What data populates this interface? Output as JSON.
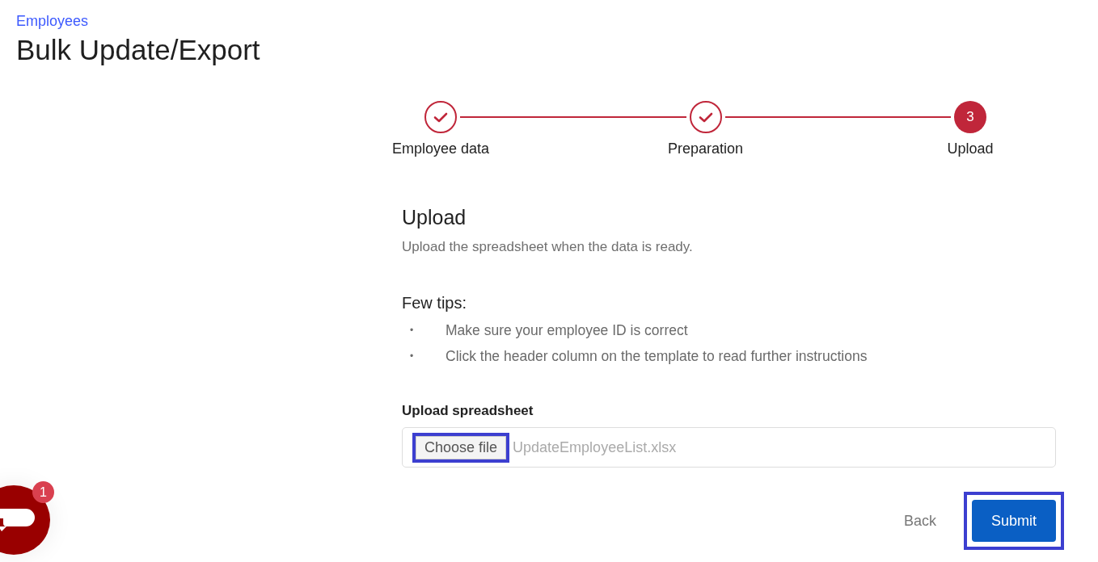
{
  "breadcrumb": "Employees",
  "title": "Bulk Update/Export",
  "steps": [
    {
      "label": "Employee data",
      "done": true
    },
    {
      "label": "Preparation",
      "done": true
    },
    {
      "label": "Upload",
      "done": false,
      "number": "3"
    }
  ],
  "section": {
    "heading": "Upload",
    "description": "Upload the spreadsheet when the data is ready."
  },
  "tips": {
    "heading": "Few tips:",
    "items": [
      {
        "bullet": "•",
        "text": "Make sure your employee ID is correct"
      },
      {
        "bullet": "•",
        "text": "Click the header column on the template to read further instructions"
      }
    ]
  },
  "upload": {
    "label": "Upload spreadsheet",
    "button": "Choose file",
    "button_highlighted": true,
    "file_name": "UpdateEmployeeList.xlsx"
  },
  "actions": {
    "back": "Back",
    "submit": "Submit",
    "submit_highlighted": true
  },
  "chat": {
    "badge": "1"
  }
}
